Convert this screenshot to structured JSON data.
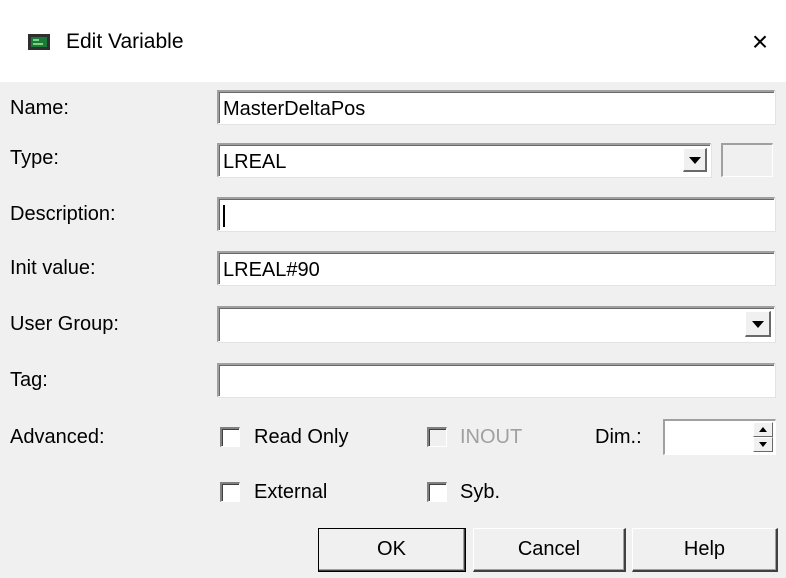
{
  "dialog": {
    "title": "Edit Variable",
    "close_symbol": "×"
  },
  "fields": {
    "name": {
      "label": "Name:",
      "value": "MasterDeltaPos"
    },
    "type": {
      "label": "Type:",
      "value": "LREAL"
    },
    "description": {
      "label": "Description:",
      "value": ""
    },
    "init_value": {
      "label": "Init value:",
      "value": "LREAL#90"
    },
    "user_group": {
      "label": "User Group:",
      "value": ""
    },
    "tag": {
      "label": "Tag:",
      "value": ""
    }
  },
  "advanced": {
    "label": "Advanced:",
    "read_only": {
      "label": "Read Only",
      "checked": false
    },
    "inout": {
      "label": "INOUT",
      "checked": false,
      "disabled": true
    },
    "dim_label": "Dim.:",
    "dim_value": "",
    "external": {
      "label": "External",
      "checked": false
    },
    "syb": {
      "label": "Syb.",
      "checked": false
    }
  },
  "buttons": {
    "ok": "OK",
    "cancel": "Cancel",
    "help": "Help"
  },
  "icons": {
    "app": "variable-chip-icon",
    "close": "close-icon"
  },
  "colors": {
    "dialog_bg": "#f0f0f0",
    "titlebar_bg": "#ffffff",
    "disabled_text": "#a0a0a0"
  }
}
